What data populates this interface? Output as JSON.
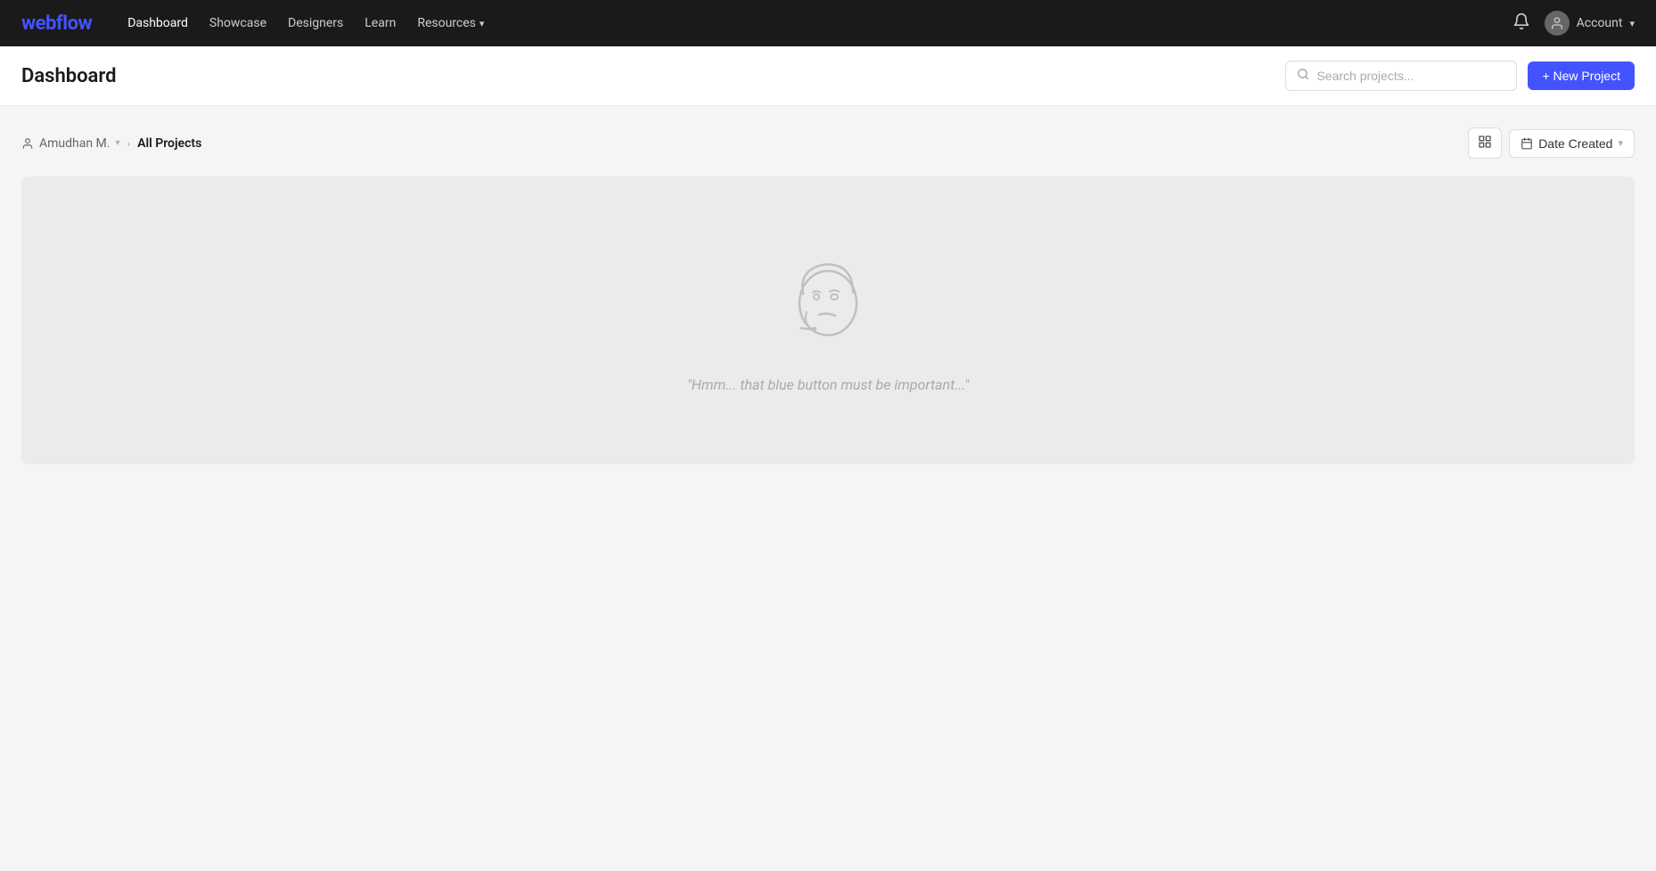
{
  "navbar": {
    "logo": "webflow",
    "links": [
      {
        "label": "Dashboard",
        "active": true
      },
      {
        "label": "Showcase",
        "active": false
      },
      {
        "label": "Designers",
        "active": false
      },
      {
        "label": "Learn",
        "active": false
      },
      {
        "label": "Resources",
        "active": false,
        "hasDropdown": true
      }
    ],
    "account_label": "Account",
    "account_dropdown_icon": "▾"
  },
  "header": {
    "title": "Dashboard",
    "search_placeholder": "Search projects...",
    "new_project_label": "+ New Project"
  },
  "breadcrumb": {
    "user": "Amudhan M.",
    "separator": "›",
    "current": "All Projects"
  },
  "toolbar": {
    "sort_label": "Date Created",
    "sort_dropdown_icon": "▾",
    "view_toggle_icon": "grid"
  },
  "empty_state": {
    "message": "\"Hmm... that blue button must be important...\""
  }
}
